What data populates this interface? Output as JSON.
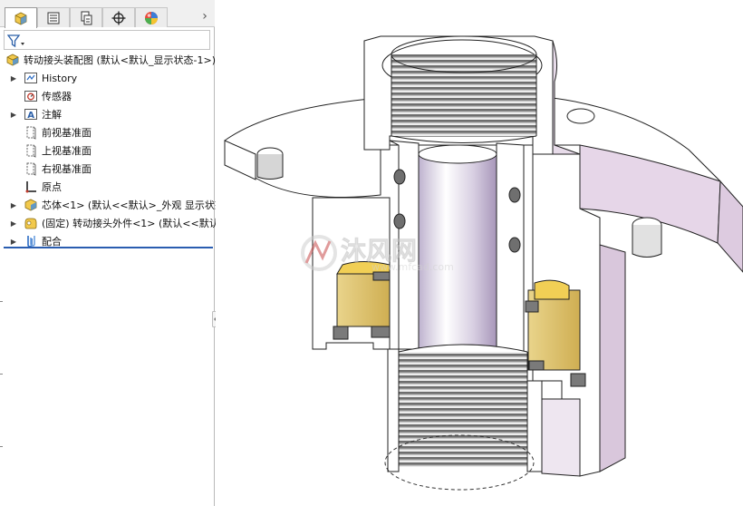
{
  "tabs": [
    {
      "name": "feature-manager",
      "icon": "feature-tree-icon",
      "active": true
    },
    {
      "name": "property-manager",
      "icon": "property-list-icon",
      "active": false
    },
    {
      "name": "configuration-manager",
      "icon": "configuration-icon",
      "active": false
    },
    {
      "name": "dim-xpert-manager",
      "icon": "crosshair-icon",
      "active": false
    },
    {
      "name": "display-manager",
      "icon": "appearance-sphere-icon",
      "active": false
    }
  ],
  "filter": {
    "icon": "funnel-icon"
  },
  "tree": {
    "root": {
      "label": "转动接头装配图 (默认<默认_显示状态-1>)",
      "icon": "assembly-icon"
    },
    "items": [
      {
        "label": "History",
        "icon": "history-icon",
        "expander": true
      },
      {
        "label": "传感器",
        "icon": "sensor-icon",
        "expander": false
      },
      {
        "label": "注解",
        "icon": "annotation-icon",
        "expander": true
      },
      {
        "label": "前视基准面",
        "icon": "plane-icon",
        "expander": false
      },
      {
        "label": "上视基准面",
        "icon": "plane-icon",
        "expander": false
      },
      {
        "label": "右视基准面",
        "icon": "plane-icon",
        "expander": false
      },
      {
        "label": "原点",
        "icon": "origin-icon",
        "expander": false
      },
      {
        "label": "芯体<1> (默认<<默认>_外观 显示状态",
        "icon": "part-icon",
        "expander": true
      },
      {
        "label": "(固定) 转动接头外件<1> (默认<<默认",
        "icon": "part-fixed-icon",
        "expander": true
      },
      {
        "label": "配合",
        "icon": "mates-icon",
        "expander": true
      }
    ]
  },
  "watermark": {
    "brand": "沐风网",
    "url": "www.mfcad.com"
  },
  "colors": {
    "thread": "#7a7a7a",
    "seal": "#e3c97a",
    "flange_side": "#d9c7dc",
    "bore": "#c9bfd6",
    "tree_divider": "#2a5db0"
  }
}
